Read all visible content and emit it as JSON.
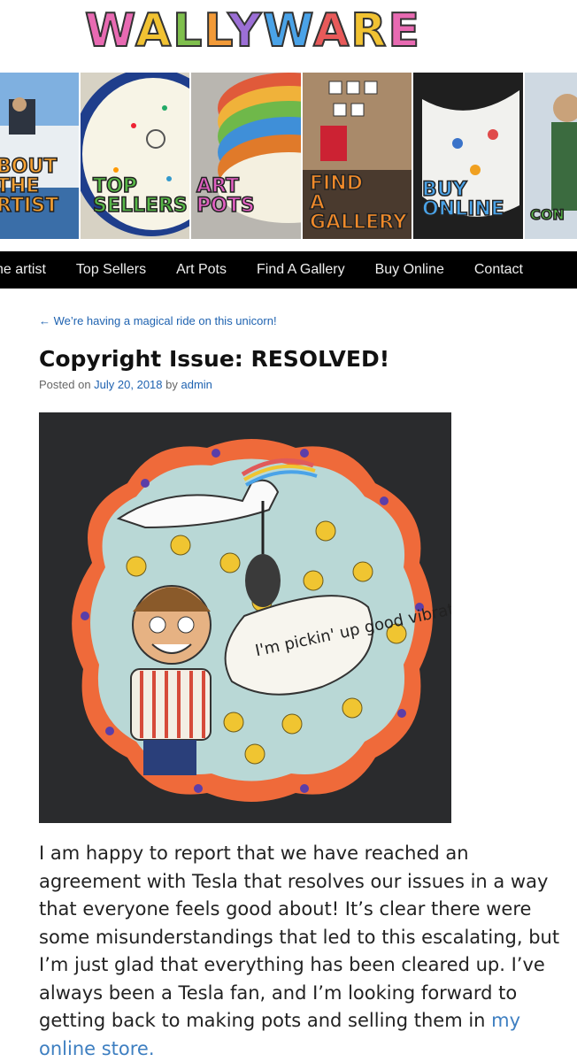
{
  "site": {
    "logo_letters": [
      "W",
      "A",
      "L",
      "L",
      "Y",
      "W",
      "A",
      "R",
      "E"
    ],
    "logo_colors": [
      "#e86ab2",
      "#f1c232",
      "#7fbf4d",
      "#f29a38",
      "#9c6fd6",
      "#4aa3e8",
      "#e85a5a",
      "#f1c232",
      "#e86ab2"
    ]
  },
  "banner": {
    "tiles": [
      {
        "label": "BOUT\nTHE\nRTIST",
        "bg": "#4f86c6"
      },
      {
        "label": "TOP\nSELLERS",
        "bg": "#f4f1df"
      },
      {
        "label": "ART\nPOTS",
        "bg": "#e08a3a"
      },
      {
        "label": "FIND\nA\nGALLERY",
        "bg": "#7a5b43"
      },
      {
        "label": "BUY\nONLINE",
        "bg": "#1f1f1f"
      },
      {
        "label": "CON",
        "bg": "#cfd9e2"
      }
    ]
  },
  "nav": {
    "items": [
      "he artist",
      "Top Sellers",
      "Art Pots",
      "Find A Gallery",
      "Buy Online",
      "Contact"
    ]
  },
  "post": {
    "prev_link": "← We’re having a magical ride on this unicorn!",
    "title": "Copyright Issue: RESOLVED!",
    "meta_prefix": "Posted on",
    "date": "July 20, 2018",
    "meta_by": "by",
    "author": "admin",
    "image_speech": "I'm pickin' up good vibrations!!",
    "body_text": "I am happy to report that we have reached an agreement with Tesla that resolves our issues in a way that everyone feels good about! It’s clear there were some misunderstandings that led to this escalating, but I’m just glad that everything has been cleared up. I’ve always been a Tesla fan, and I’m looking forward to getting back to making pots and selling them in",
    "store_link": "my online store."
  }
}
